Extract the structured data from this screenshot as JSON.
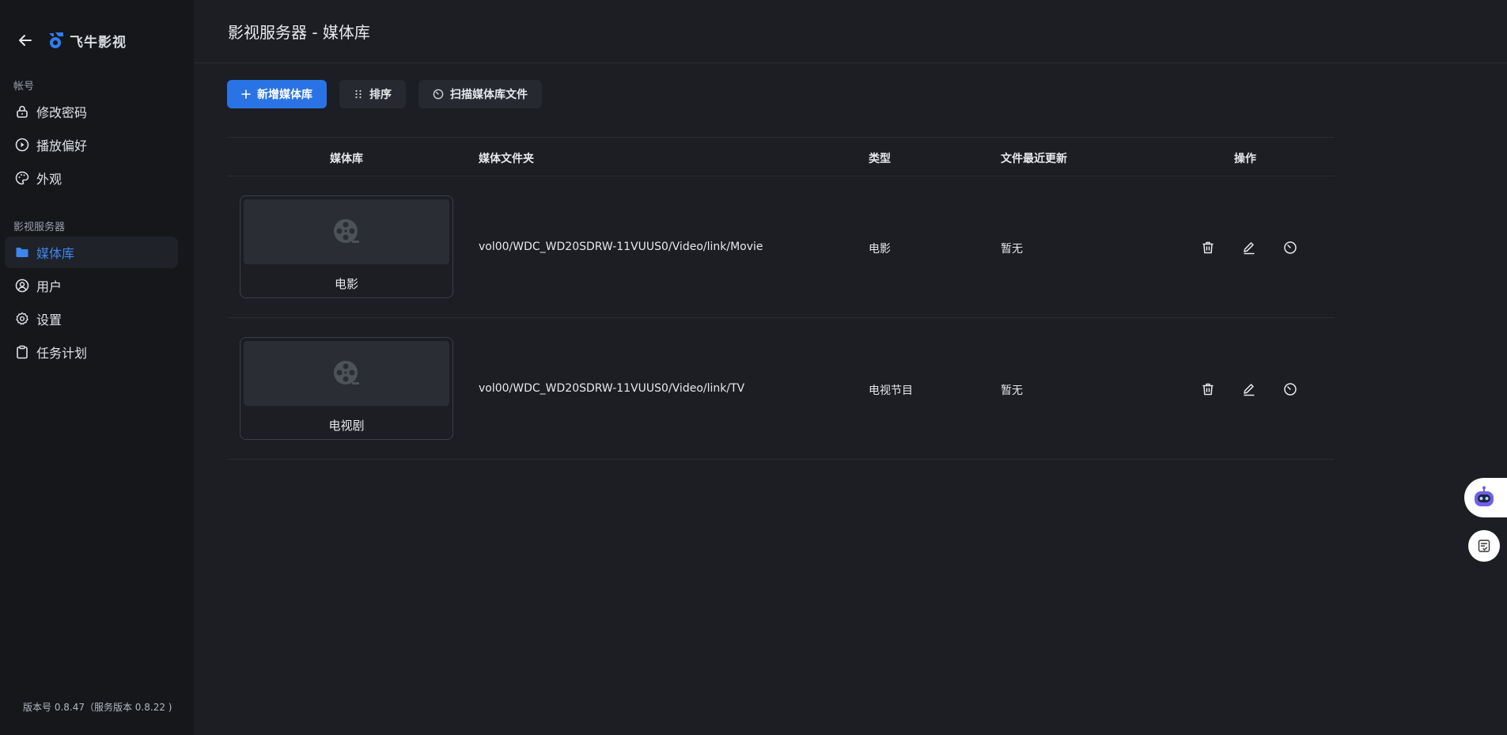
{
  "app": {
    "logo_text": "飞牛影视"
  },
  "sidebar": {
    "section_account": "帐号",
    "section_server": "影视服务器",
    "account_items": [
      {
        "label": "修改密码",
        "icon": "lock-icon"
      },
      {
        "label": "播放偏好",
        "icon": "play-circle-icon"
      },
      {
        "label": "外观",
        "icon": "palette-icon"
      }
    ],
    "server_items": [
      {
        "label": "媒体库",
        "icon": "folder-icon",
        "active": true
      },
      {
        "label": "用户",
        "icon": "user-circle-icon"
      },
      {
        "label": "设置",
        "icon": "gear-icon"
      },
      {
        "label": "任务计划",
        "icon": "clipboard-icon"
      }
    ],
    "version": "版本号 0.8.47（服务版本 0.8.22 )"
  },
  "header": {
    "title": "影视服务器 - 媒体库"
  },
  "toolbar": {
    "add_label": "新增媒体库",
    "sort_label": "排序",
    "scan_label": "扫描媒体库文件"
  },
  "table": {
    "headers": {
      "library": "媒体库",
      "folder": "媒体文件夹",
      "type": "类型",
      "updated": "文件最近更新",
      "actions": "操作"
    },
    "rows": [
      {
        "name": "电影",
        "folder": "vol00/WDC_WD20SDRW-11VUUS0/Video/link/Movie",
        "type": "电影",
        "updated": "暂无"
      },
      {
        "name": "电视剧",
        "folder": "vol00/WDC_WD20SDRW-11VUUS0/Video/link/TV",
        "type": "电视节目",
        "updated": "暂无"
      }
    ]
  },
  "colors": {
    "accent": "#2a73e4",
    "active_nav": "#3d86f0",
    "background": "#1c1e23",
    "sidebar": "#15171b"
  }
}
